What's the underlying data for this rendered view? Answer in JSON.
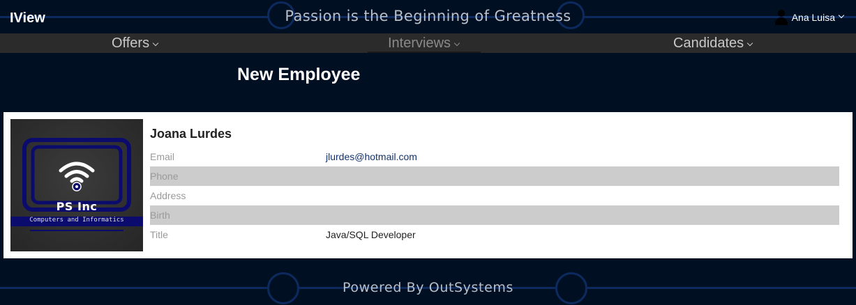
{
  "header": {
    "brand": "IView",
    "tagline": "Passion is the Beginning of Greatness",
    "user_name": "Ana Luisa"
  },
  "nav": {
    "items": [
      {
        "label": "Offers"
      },
      {
        "label": "Interviews"
      },
      {
        "label": "Candidates"
      }
    ],
    "active": "Interviews"
  },
  "page": {
    "title": "New Employee"
  },
  "employee": {
    "name": "Joana Lurdes",
    "logo": {
      "title": "PS Inc",
      "subtitle": "Computers and Informatics"
    },
    "fields": [
      {
        "label": "Email",
        "value": "jlurdes@hotmail.com"
      },
      {
        "label": "Phone",
        "value": ""
      },
      {
        "label": "Address",
        "value": ""
      },
      {
        "label": "Birth",
        "value": ""
      },
      {
        "label": "Title",
        "value": "Java/SQL Developer"
      }
    ]
  },
  "footer": {
    "text": "Powered By OutSystems"
  },
  "colors": {
    "background": "#010f22",
    "nav": "#2b2b2b",
    "accent_line": "#0d2a5e",
    "link": "#13306b",
    "row_shade": "#cccccc"
  }
}
